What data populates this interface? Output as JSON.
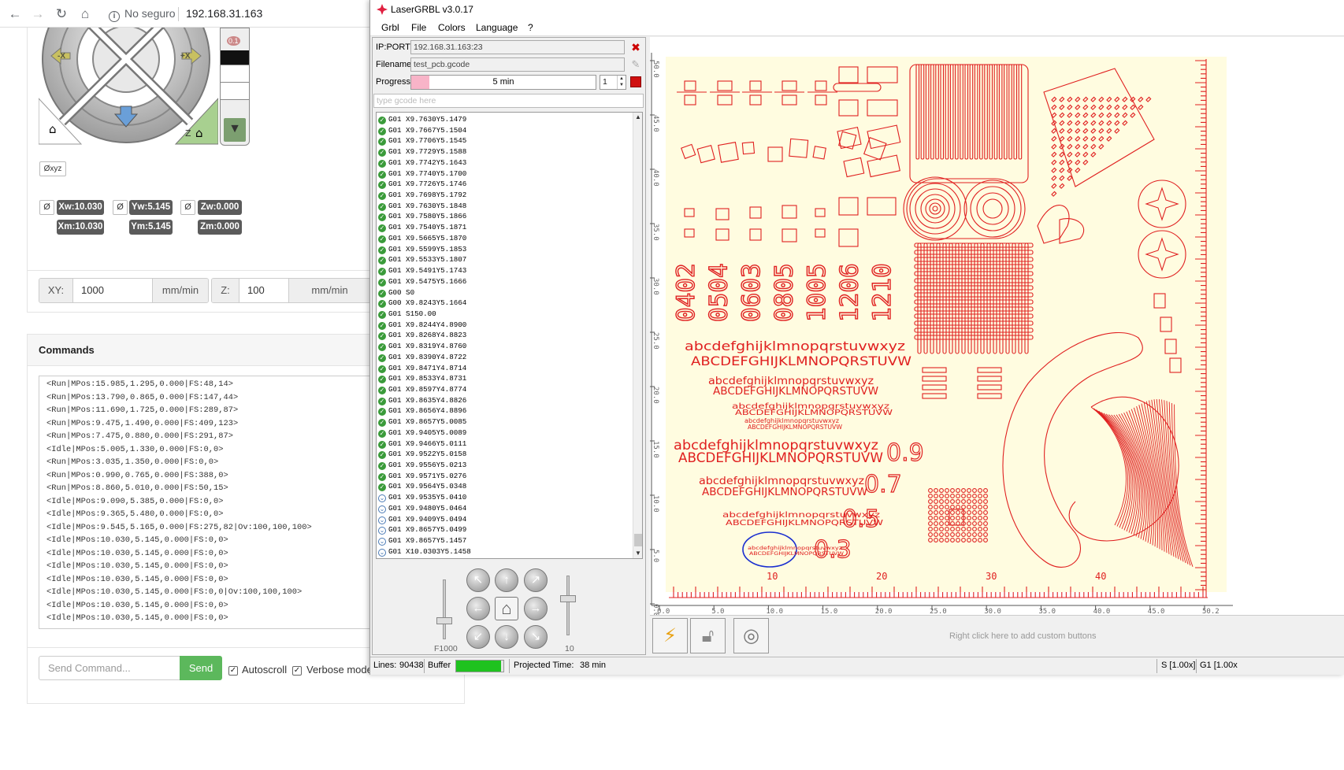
{
  "browser": {
    "security_label": "No seguro",
    "url": "192.168.31.163"
  },
  "web": {
    "reset_xyz": "Øxyz",
    "positions": [
      {
        "reset": "Ø",
        "work": "Xw:10.030",
        "machine": "Xm:10.030"
      },
      {
        "reset": "Ø",
        "work": "Yw:5.145",
        "machine": "Ym:5.145"
      },
      {
        "reset": "Ø",
        "work": "Zw:0.000",
        "machine": "Zm:0.000"
      }
    ],
    "feed": {
      "xy_label": "XY:",
      "xy_value": "1000",
      "xy_unit": "mm/min",
      "z_label": "Z:",
      "z_value": "100",
      "z_unit": "mm/min"
    },
    "jog_labels": {
      "x_minus": "-X",
      "x_plus": "+X",
      "z_label": "Z",
      "z_step": "0.1"
    },
    "commands": {
      "title": "Commands",
      "log": [
        "<Run|MPos:15.985,1.295,0.000|FS:48,14>",
        "<Run|MPos:13.790,0.865,0.000|FS:147,44>",
        "<Run|MPos:11.690,1.725,0.000|FS:289,87>",
        "<Run|MPos:9.475,1.490,0.000|FS:409,123>",
        "<Run|MPos:7.475,0.880,0.000|FS:291,87>",
        "<Idle|MPos:5.005,1.330,0.000|FS:0,0>",
        "<Run|MPos:3.035,1.350,0.000|FS:0,0>",
        "<Run|MPos:0.990,0.765,0.000|FS:388,0>",
        "<Run|MPos:8.860,5.010,0.000|FS:50,15>",
        "<Idle|MPos:9.090,5.385,0.000|FS:0,0>",
        "<Idle|MPos:9.365,5.480,0.000|FS:0,0>",
        "<Idle|MPos:9.545,5.165,0.000|FS:275,82|Ov:100,100,100>",
        "<Idle|MPos:10.030,5.145,0.000|FS:0,0>",
        "<Idle|MPos:10.030,5.145,0.000|FS:0,0>",
        "<Idle|MPos:10.030,5.145,0.000|FS:0,0>",
        "<Idle|MPos:10.030,5.145,0.000|FS:0,0>",
        "<Idle|MPos:10.030,5.145,0.000|FS:0,0|Ov:100,100,100>",
        "<Idle|MPos:10.030,5.145,0.000|FS:0,0>",
        "<Idle|MPos:10.030,5.145,0.000|FS:0,0>"
      ],
      "placeholder": "Send Command...",
      "send": "Send",
      "autoscroll": "Autoscroll",
      "verbose": "Verbose mode"
    }
  },
  "laser": {
    "title": "LaserGRBL v3.0.17",
    "menu": [
      "Grbl",
      "File",
      "Colors",
      "Language",
      "?"
    ],
    "ip_label": "IP:PORT",
    "ip_value": "192.168.31.163:23",
    "filename_label": "Filename",
    "filename_value": "test_pcb.gcode",
    "progress_label": "Progress",
    "progress_text": "5 min",
    "progress_fraction": 0.1,
    "repeat": "1",
    "gcode_placeholder": "type gcode here",
    "gcode": [
      {
        "s": "ok",
        "t": "G01 X9.7630Y5.1479"
      },
      {
        "s": "ok",
        "t": "G01 X9.7667Y5.1504"
      },
      {
        "s": "ok",
        "t": "G01 X9.7706Y5.1545"
      },
      {
        "s": "ok",
        "t": "G01 X9.7729Y5.1588"
      },
      {
        "s": "ok",
        "t": "G01 X9.7742Y5.1643"
      },
      {
        "s": "ok",
        "t": "G01 X9.7740Y5.1700"
      },
      {
        "s": "ok",
        "t": "G01 X9.7726Y5.1746"
      },
      {
        "s": "ok",
        "t": "G01 X9.7698Y5.1792"
      },
      {
        "s": "ok",
        "t": "G01 X9.7630Y5.1848"
      },
      {
        "s": "ok",
        "t": "G01 X9.7580Y5.1866"
      },
      {
        "s": "ok",
        "t": "G01 X9.7540Y5.1871"
      },
      {
        "s": "ok",
        "t": "G01 X9.5665Y5.1870"
      },
      {
        "s": "ok",
        "t": "G01 X9.5599Y5.1853"
      },
      {
        "s": "ok",
        "t": "G01 X9.5533Y5.1807"
      },
      {
        "s": "ok",
        "t": "G01 X9.5491Y5.1743"
      },
      {
        "s": "ok",
        "t": "G01 X9.5475Y5.1666"
      },
      {
        "s": "ok",
        "t": "G00 S0"
      },
      {
        "s": "ok",
        "t": "G00 X9.8243Y5.1664"
      },
      {
        "s": "ok",
        "t": "G01 S150.00"
      },
      {
        "s": "ok",
        "t": "G01 X9.8244Y4.8900"
      },
      {
        "s": "ok",
        "t": "G01 X9.8268Y4.8823"
      },
      {
        "s": "ok",
        "t": "G01 X9.8319Y4.8760"
      },
      {
        "s": "ok",
        "t": "G01 X9.8390Y4.8722"
      },
      {
        "s": "ok",
        "t": "G01 X9.8471Y4.8714"
      },
      {
        "s": "ok",
        "t": "G01 X9.8533Y4.8731"
      },
      {
        "s": "ok",
        "t": "G01 X9.8597Y4.8774"
      },
      {
        "s": "ok",
        "t": "G01 X9.8635Y4.8826"
      },
      {
        "s": "ok",
        "t": "G01 X9.8656Y4.8896"
      },
      {
        "s": "ok",
        "t": "G01 X9.8657Y5.0085"
      },
      {
        "s": "ok",
        "t": "G01 X9.9405Y5.0089"
      },
      {
        "s": "ok",
        "t": "G01 X9.9466Y5.0111"
      },
      {
        "s": "ok",
        "t": "G01 X9.9522Y5.0158"
      },
      {
        "s": "ok",
        "t": "G01 X9.9556Y5.0213"
      },
      {
        "s": "ok",
        "t": "G01 X9.9571Y5.0276"
      },
      {
        "s": "ok",
        "t": "G01 X9.9564Y5.0348"
      },
      {
        "s": "wait",
        "t": "G01 X9.9535Y5.0410"
      },
      {
        "s": "wait",
        "t": "G01 X9.9480Y5.0464"
      },
      {
        "s": "wait",
        "t": "G01 X9.9409Y5.0494"
      },
      {
        "s": "wait",
        "t": "G01 X9.8657Y5.0499"
      },
      {
        "s": "wait",
        "t": "G01 X9.8657Y5.1457"
      },
      {
        "s": "wait",
        "t": "G01 X10.0303Y5.1458"
      }
    ],
    "speed_left": "F1000",
    "speed_right": "10",
    "axis_x_ticks": [
      "0.0",
      "5.0",
      "10.0",
      "15.0",
      "20.0",
      "25.0",
      "30.0",
      "35.0",
      "40.0",
      "45.0",
      "50.2"
    ],
    "axis_y_ticks": [
      "50.0",
      "45.0",
      "40.0",
      "35.0",
      "30.0",
      "25.0",
      "20.0",
      "15.0",
      "10.0",
      "5.0",
      "0.0"
    ],
    "board_numbers_x": [
      "10",
      "20",
      "30",
      "40"
    ],
    "packages": [
      "0402",
      "0504",
      "0603",
      "0805",
      "1005",
      "1206",
      "1210"
    ],
    "alphabet_lower": "abcdefghijklmnopqrstuvwxyz",
    "alphabet_upper": "ABCDEFGHIJKLMNOPQRSTUVW",
    "sizes": [
      "0.9",
      "0.7",
      "0.5",
      "0.3"
    ],
    "custom_buttons_hint": "Right click here to add custom buttons",
    "status": {
      "lines_label": "Lines:",
      "lines_value": "90438",
      "buffer_label": "Buffer",
      "buffer_fraction": 0.95,
      "projected_label": "Projected Time:",
      "projected_value": "38 min",
      "s_override": "S [1.00x]",
      "g1_override": "G1 [1.00x"
    },
    "colors": {
      "trace": "#e02020",
      "board": "#fffce0",
      "cursor": "#1a2fd0"
    }
  }
}
